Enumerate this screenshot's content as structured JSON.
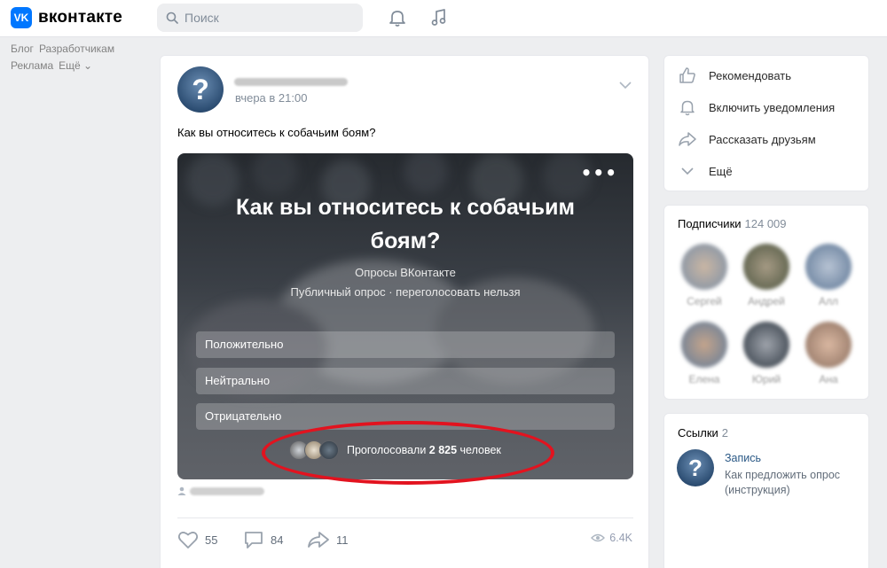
{
  "header": {
    "logo_letters": "VK",
    "logo_text": "вконтакте",
    "search_placeholder": "Поиск"
  },
  "left_nav": {
    "items": [
      "Блог",
      "Разработчикам",
      "Реклама",
      "Ещё ⌄"
    ]
  },
  "post": {
    "time": "вчера в 21:00",
    "text": "Как вы относитесь к собачьим боям?",
    "poll": {
      "more": "•••",
      "question": "Как вы относитесь к собачьим боям?",
      "author": "Опросы ВКонтакте",
      "subtitle": "Публичный опрос · переголосовать нельзя",
      "options": [
        "Положительно",
        "Нейтрально",
        "Отрицательно"
      ],
      "voted_text": "Проголосовали ",
      "voted_count": "2 825",
      "voted_suffix": " человек"
    },
    "likes": "55",
    "comments": "84",
    "shares": "11",
    "views": "6.4K"
  },
  "right_menu": {
    "items": [
      "Рекомендовать",
      "Включить уведомления",
      "Рассказать друзьям",
      "Ещё"
    ]
  },
  "subscribers": {
    "title": "Подписчики",
    "count": "124 009",
    "names": [
      "Сергей",
      "Андрей",
      "Алл",
      "Елена",
      "Юрий",
      "Ана"
    ]
  },
  "links": {
    "title": "Ссылки",
    "count": "2",
    "item_title": "Запись",
    "item_desc": "Как предложить опрос (инструкция)"
  },
  "colors": {
    "brand": "#0077ff",
    "annotation": "#e2131f",
    "link": "#2a5885"
  }
}
